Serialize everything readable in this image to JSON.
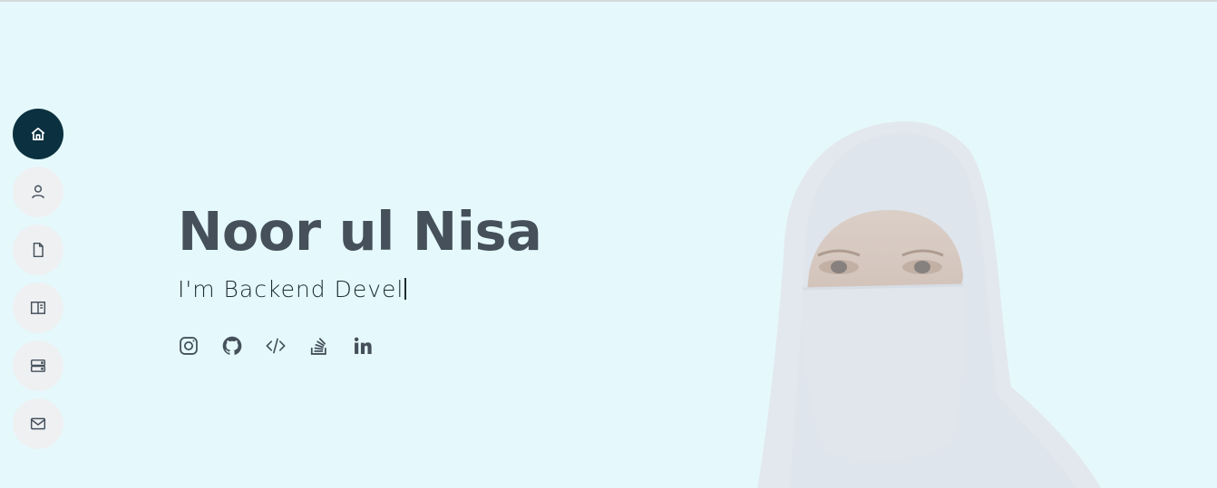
{
  "hero": {
    "name": "Noor ul Nisa",
    "tagline": "I'm Backend Devel"
  },
  "nav": {
    "items": [
      {
        "name": "home",
        "icon": "house-icon",
        "active": true
      },
      {
        "name": "about",
        "icon": "person-icon",
        "active": false
      },
      {
        "name": "resume",
        "icon": "file-icon",
        "active": false
      },
      {
        "name": "portfolio",
        "icon": "book-open-icon",
        "active": false
      },
      {
        "name": "services",
        "icon": "server-icon",
        "active": false
      },
      {
        "name": "contact",
        "icon": "envelope-icon",
        "active": false
      }
    ]
  },
  "socials": [
    {
      "name": "instagram",
      "icon": "instagram-icon"
    },
    {
      "name": "github",
      "icon": "github-icon"
    },
    {
      "name": "code",
      "icon": "code-slash-icon"
    },
    {
      "name": "stackoverflow",
      "icon": "stack-overflow-icon"
    },
    {
      "name": "linkedin",
      "icon": "linkedin-icon"
    }
  ],
  "colors": {
    "hero_bg": "#e5f9fc",
    "nav_active": "#0b3140",
    "nav_inactive": "#eef0f2",
    "text": "#45505b"
  }
}
